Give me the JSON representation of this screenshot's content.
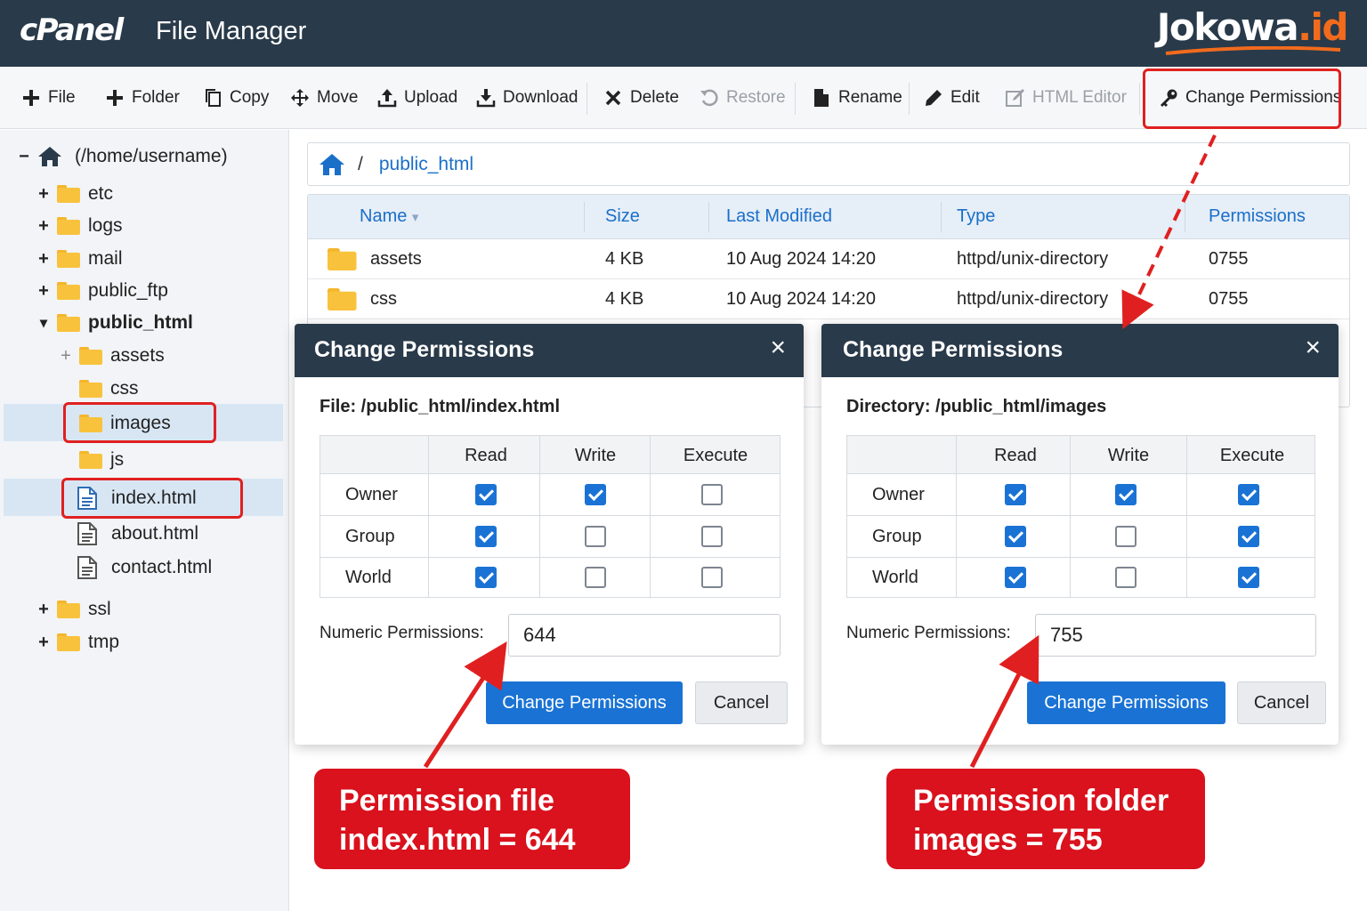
{
  "header": {
    "logo_text": "cPanel",
    "app_title": "File Manager",
    "brand_main": "Jokowa",
    "brand_accent": ".id",
    "bg_color": "#293a4a",
    "brand_accent_color": "#f26b1d"
  },
  "toolbar": {
    "items": [
      {
        "label": "File",
        "icon": "plus-icon"
      },
      {
        "label": "Folder",
        "icon": "plus-icon"
      },
      {
        "label": "Copy",
        "icon": "copy-icon"
      },
      {
        "label": "Move",
        "icon": "move-icon"
      },
      {
        "label": "Upload",
        "icon": "upload-icon"
      },
      {
        "label": "Download",
        "icon": "download-icon"
      },
      {
        "label": "Delete",
        "icon": "close-icon"
      },
      {
        "label": "Restore",
        "icon": "restore-icon",
        "disabled": true
      },
      {
        "label": "Rename",
        "icon": "file-icon"
      },
      {
        "label": "Edit",
        "icon": "pencil-icon"
      },
      {
        "label": "HTML Editor",
        "icon": "html-editor-icon",
        "disabled": true
      },
      {
        "label": "Change Permissions",
        "icon": "key-icon",
        "highlighted": true
      }
    ]
  },
  "sidebar": {
    "root_label": "(/home/username)",
    "root_toggle": "−",
    "items": [
      {
        "label": "etc",
        "toggle": "+"
      },
      {
        "label": "logs",
        "toggle": "+"
      },
      {
        "label": "mail",
        "toggle": "+"
      },
      {
        "label": "public_ftp",
        "toggle": "+"
      },
      {
        "label": "public_html",
        "toggle": "▾",
        "bold": true
      },
      {
        "label": "assets",
        "toggle": "+"
      },
      {
        "label": "css"
      },
      {
        "label": "images",
        "selected": true,
        "highlighted": true
      },
      {
        "label": "js"
      },
      {
        "label": "index.html",
        "selected": true,
        "highlighted": true
      },
      {
        "label": "about.html"
      },
      {
        "label": "contact.html"
      },
      {
        "label": "ssl",
        "toggle": "+"
      },
      {
        "label": "tmp",
        "toggle": "+"
      }
    ]
  },
  "breadcrumb": {
    "separator": "/",
    "current": "public_html"
  },
  "file_table": {
    "columns": [
      "Name",
      "Size",
      "Last Modified",
      "Type",
      "Permissions"
    ],
    "sort_indicator": "▾",
    "rows": [
      {
        "name": "assets",
        "size": "4 KB",
        "modified": "10 Aug 2024 14:20",
        "type": "httpd/unix-directory",
        "perms": "0755"
      },
      {
        "name": "css",
        "size": "4 KB",
        "modified": "10 Aug 2024 14:20",
        "type": "httpd/unix-directory",
        "perms": "0755"
      }
    ]
  },
  "dialog_file": {
    "title": "Change Permissions",
    "close": "×",
    "path": "File: /public_html/index.html",
    "columns": [
      "Read",
      "Write",
      "Execute"
    ],
    "rows": [
      {
        "label": "Owner",
        "read": true,
        "write": true,
        "execute": false
      },
      {
        "label": "Group",
        "read": true,
        "write": false,
        "execute": false
      },
      {
        "label": "World",
        "read": true,
        "write": false,
        "execute": false
      }
    ],
    "numeric_label": "Numeric Permissions:",
    "numeric_value": "644",
    "submit_label": "Change Permissions",
    "cancel_label": "Cancel"
  },
  "dialog_folder": {
    "title": "Change Permissions",
    "close": "×",
    "path": "Directory: /public_html/images",
    "columns": [
      "Read",
      "Write",
      "Execute"
    ],
    "rows": [
      {
        "label": "Owner",
        "read": true,
        "write": true,
        "execute": true
      },
      {
        "label": "Group",
        "read": true,
        "write": false,
        "execute": true
      },
      {
        "label": "World",
        "read": true,
        "write": false,
        "execute": true
      }
    ],
    "numeric_label": "Numeric Permissions:",
    "numeric_value": "755",
    "submit_label": "Change Permissions",
    "cancel_label": "Cancel"
  },
  "callouts": {
    "file_line1": "Permission file",
    "file_line2": "index.html = 644",
    "folder_line1": "Permission folder",
    "folder_line2": "images = 755",
    "color": "#d9121d"
  }
}
